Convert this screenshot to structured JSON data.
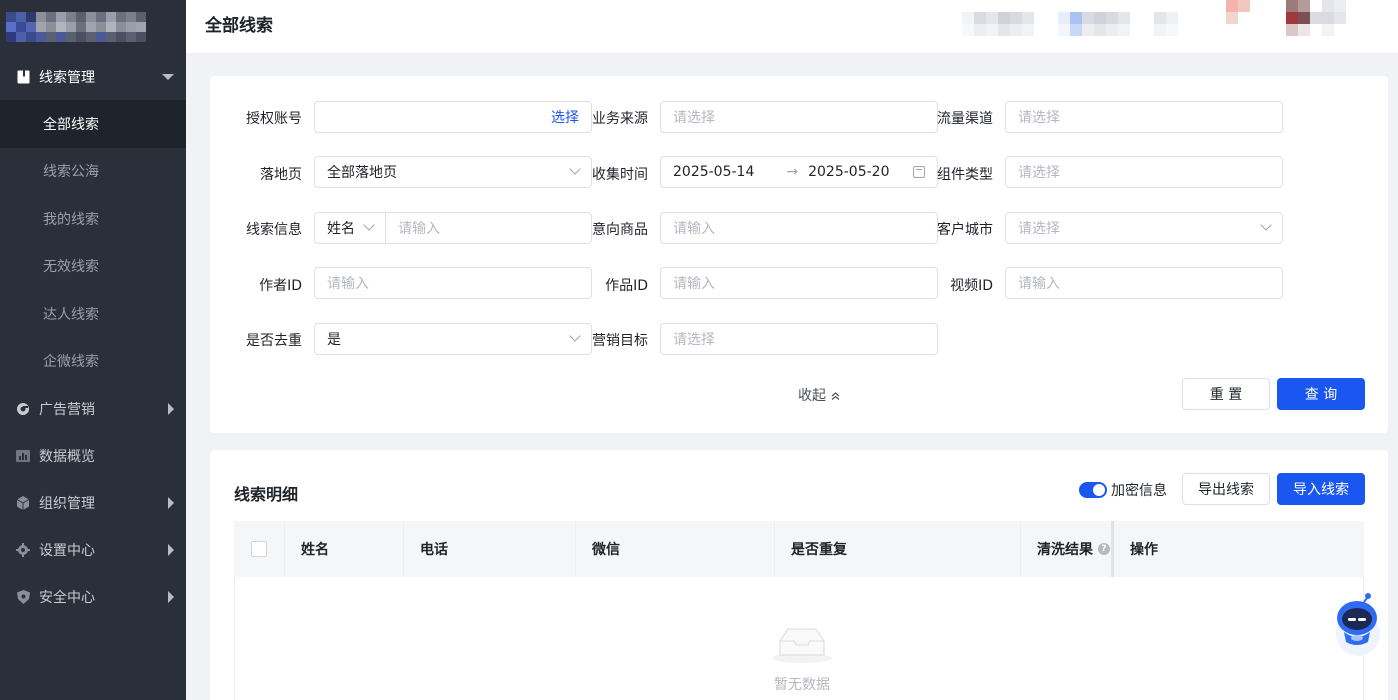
{
  "header": {
    "page_title": "全部线索"
  },
  "sidebar": {
    "groups": [
      {
        "label": "线索管理",
        "icon": "book-icon"
      },
      {
        "label": "广告营销",
        "icon": "target-icon"
      },
      {
        "label": "数据概览",
        "icon": "chart-icon"
      },
      {
        "label": "组织管理",
        "icon": "cube-icon"
      },
      {
        "label": "设置中心",
        "icon": "gear-icon"
      },
      {
        "label": "安全中心",
        "icon": "shield-icon"
      }
    ],
    "sub_items": [
      "全部线索",
      "线索公海",
      "我的线索",
      "无效线索",
      "达人线索",
      "企微线索"
    ]
  },
  "filters": {
    "auth_account": {
      "label": "授权账号",
      "action": "选择"
    },
    "biz_source": {
      "label": "业务来源",
      "placeholder": "请选择"
    },
    "traffic_channel": {
      "label": "流量渠道",
      "placeholder": "请选择"
    },
    "landing_page": {
      "label": "落地页",
      "value": "全部落地页"
    },
    "collect_time": {
      "label": "收集时间",
      "start": "2025-05-14",
      "end": "2025-05-20",
      "separator": "→"
    },
    "component_type": {
      "label": "组件类型",
      "placeholder": "请选择"
    },
    "lead_info": {
      "label": "线索信息",
      "type_value": "姓名",
      "placeholder": "请输入"
    },
    "intent_product": {
      "label": "意向商品",
      "placeholder": "请输入"
    },
    "customer_city": {
      "label": "客户城市",
      "placeholder": "请选择"
    },
    "author_id": {
      "label": "作者ID",
      "placeholder": "请输入"
    },
    "work_id": {
      "label": "作品ID",
      "placeholder": "请输入"
    },
    "video_id": {
      "label": "视频ID",
      "placeholder": "请输入"
    },
    "dedupe": {
      "label": "是否去重",
      "value": "是"
    },
    "marketing_goal": {
      "label": "营销目标",
      "placeholder": "请选择"
    },
    "collapse_label": "收起",
    "reset_label": "重 置",
    "query_label": "查 询"
  },
  "table_section": {
    "title": "线索明细",
    "encrypt_toggle_label": "加密信息",
    "encrypt_on": true,
    "export_label": "导出线索",
    "import_label": "导入线索",
    "columns": [
      "姓名",
      "电话",
      "微信",
      "是否重复",
      "清洗结果",
      "操作"
    ],
    "help_glyph": "?",
    "empty_text": "暂无数据"
  },
  "colors": {
    "primary": "#1a56f0",
    "sidebar_bg": "#2a2f3a"
  }
}
